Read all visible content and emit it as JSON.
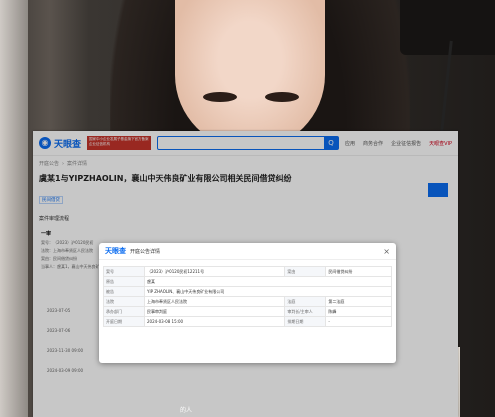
{
  "site": {
    "logo_text": "天眼查",
    "ad_text": "国家中小企业发展子基金旗下官方备案企业征信机构",
    "search_button": "Q",
    "nav": [
      "应用",
      "商务合作",
      "企业征信报告",
      "天眼查VIP"
    ],
    "breadcrumb": [
      "开庭公告",
      "案件详情"
    ]
  },
  "case": {
    "title": "虞某1与YIPZHAOLIN，襄山中天伟良矿业有限公司相关民间借贷纠纷",
    "tag": "民间借贷",
    "section": "案件审理流程",
    "subhead": "一审",
    "rows": [
      "案号：（2023）沪0120民初",
      "法院：上海市奉贤区人民法院",
      "案由：民间借贷纠纷",
      "当事人：虞某1，襄山中天伟良矿业有限公司"
    ],
    "times": [
      "2023-07-05",
      "2023-07-06",
      "2023-11-30 09:00",
      "2024-03-09 09:00"
    ]
  },
  "watermark": "百姓注",
  "dialog": {
    "logo": "天眼查",
    "title": "开庭公告详情",
    "close": "×",
    "rows": [
      {
        "k1": "案号",
        "v1": "（2023）沪0120民初12211号",
        "k2": "案由",
        "v2": "民间借贷纠纷"
      },
      {
        "k1": "原告",
        "v1": "虞某",
        "k2": "",
        "v2": ""
      },
      {
        "k1": "被告",
        "v1": "YIP ZHAOLIN、襄山中天伟良矿业有限公司",
        "k2": "",
        "v2": ""
      },
      {
        "k1": "法院",
        "v1": "上海市奉贤区人民法院",
        "k2": "法庭",
        "v2": "第二法庭"
      },
      {
        "k1": "承办部门",
        "v1": "民事审判庭",
        "k2": "审判长/主审人",
        "v2": "陈峰"
      },
      {
        "k1": "开庭日期",
        "v1": "2024-03-08 15:00",
        "k2": "排期日期",
        "v2": "-"
      }
    ]
  },
  "caption": "的人"
}
